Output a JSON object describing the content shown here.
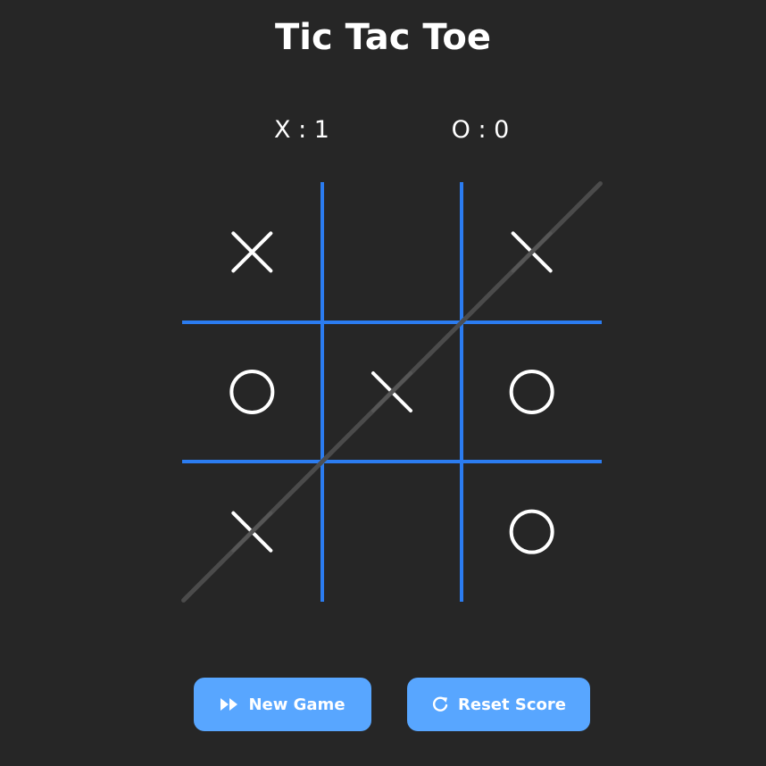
{
  "header": {
    "title": "Tic Tac Toe"
  },
  "scoreboard": {
    "x": "X : 1",
    "o": "O : 0"
  },
  "board": {
    "cells": [
      "X",
      "",
      "X",
      "O",
      "X",
      "O",
      "X",
      "",
      "O"
    ],
    "winning_line": [
      6,
      4,
      2
    ]
  },
  "colors": {
    "background": "#262626",
    "grid": "#2b7cf0",
    "mark": "#ffffff",
    "win_line": "#4d4d4d",
    "button": "#58a6ff"
  },
  "controls": {
    "new_game_label": "New Game",
    "new_game_icon": "fast-forward-icon",
    "reset_score_label": "Reset Score",
    "reset_score_icon": "refresh-icon"
  }
}
